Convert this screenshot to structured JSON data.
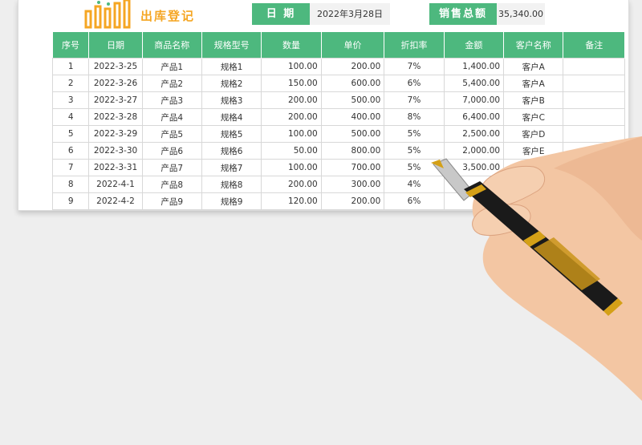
{
  "header": {
    "title": "出库登记",
    "date_label": "日 期",
    "date_value": "2022年3月28日",
    "total_label": "销售总额",
    "total_value": "35,340.00"
  },
  "table": {
    "columns": [
      "序号",
      "日期",
      "商品名称",
      "规格型号",
      "数量",
      "单价",
      "折扣率",
      "金额",
      "客户名称",
      "备注"
    ],
    "rows": [
      [
        "1",
        "2022-3-25",
        "产品1",
        "规格1",
        "100.00",
        "200.00",
        "7%",
        "1,400.00",
        "客户A",
        ""
      ],
      [
        "2",
        "2022-3-26",
        "产品2",
        "规格2",
        "150.00",
        "600.00",
        "6%",
        "5,400.00",
        "客户A",
        ""
      ],
      [
        "3",
        "2022-3-27",
        "产品3",
        "规格3",
        "200.00",
        "500.00",
        "7%",
        "7,000.00",
        "客户B",
        ""
      ],
      [
        "4",
        "2022-3-28",
        "产品4",
        "规格4",
        "200.00",
        "400.00",
        "8%",
        "6,400.00",
        "客户C",
        ""
      ],
      [
        "5",
        "2022-3-29",
        "产品5",
        "规格5",
        "100.00",
        "500.00",
        "5%",
        "2,500.00",
        "客户D",
        ""
      ],
      [
        "6",
        "2022-3-30",
        "产品6",
        "规格6",
        "50.00",
        "800.00",
        "5%",
        "2,000.00",
        "客户E",
        ""
      ],
      [
        "7",
        "2022-3-31",
        "产品7",
        "规格7",
        "100.00",
        "700.00",
        "5%",
        "3,500.00",
        "客户",
        ""
      ],
      [
        "8",
        "2022-4-1",
        "产品8",
        "规格8",
        "200.00",
        "300.00",
        "4%",
        "",
        ""
      ],
      [
        "9",
        "2022-4-2",
        "产品9",
        "规格9",
        "120.00",
        "200.00",
        "6%",
        "1,44",
        ""
      ]
    ]
  },
  "colors": {
    "accent": "#4db87e",
    "title": "#f5a623",
    "logo": "#f5a623"
  },
  "icons": {
    "logo": "bar-chart-icon"
  }
}
